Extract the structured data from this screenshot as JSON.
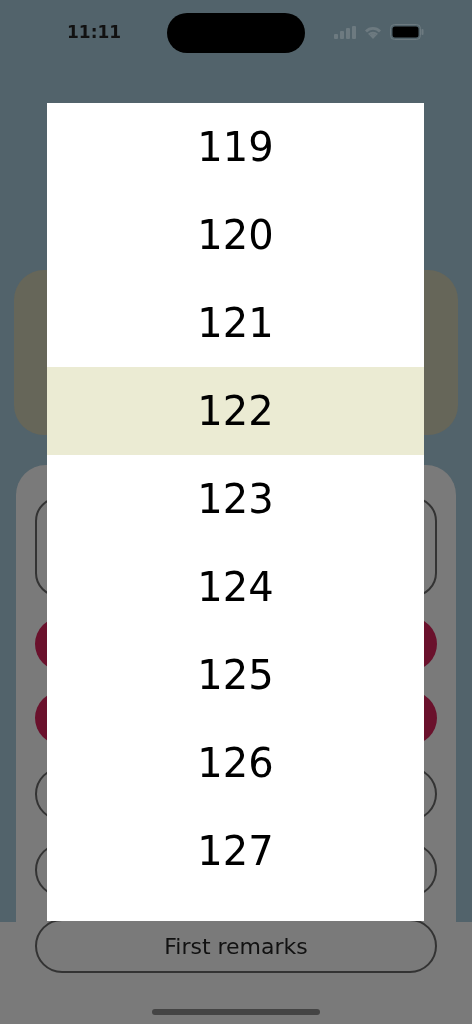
{
  "status_bar": {
    "time": "11:11"
  },
  "sheet_items": [
    {
      "kind": "box"
    },
    {
      "kind": "filled"
    },
    {
      "kind": "filled"
    },
    {
      "kind": "outlined"
    },
    {
      "kind": "outlined"
    },
    {
      "kind": "outlined",
      "label": "First remarks"
    }
  ],
  "picker": {
    "options": [
      {
        "label": "119",
        "selected": false
      },
      {
        "label": "120",
        "selected": false
      },
      {
        "label": "121",
        "selected": false
      },
      {
        "label": "122",
        "selected": true
      },
      {
        "label": "123",
        "selected": false
      },
      {
        "label": "124",
        "selected": false
      },
      {
        "label": "125",
        "selected": false
      },
      {
        "label": "126",
        "selected": false
      },
      {
        "label": "127",
        "selected": false
      }
    ]
  }
}
